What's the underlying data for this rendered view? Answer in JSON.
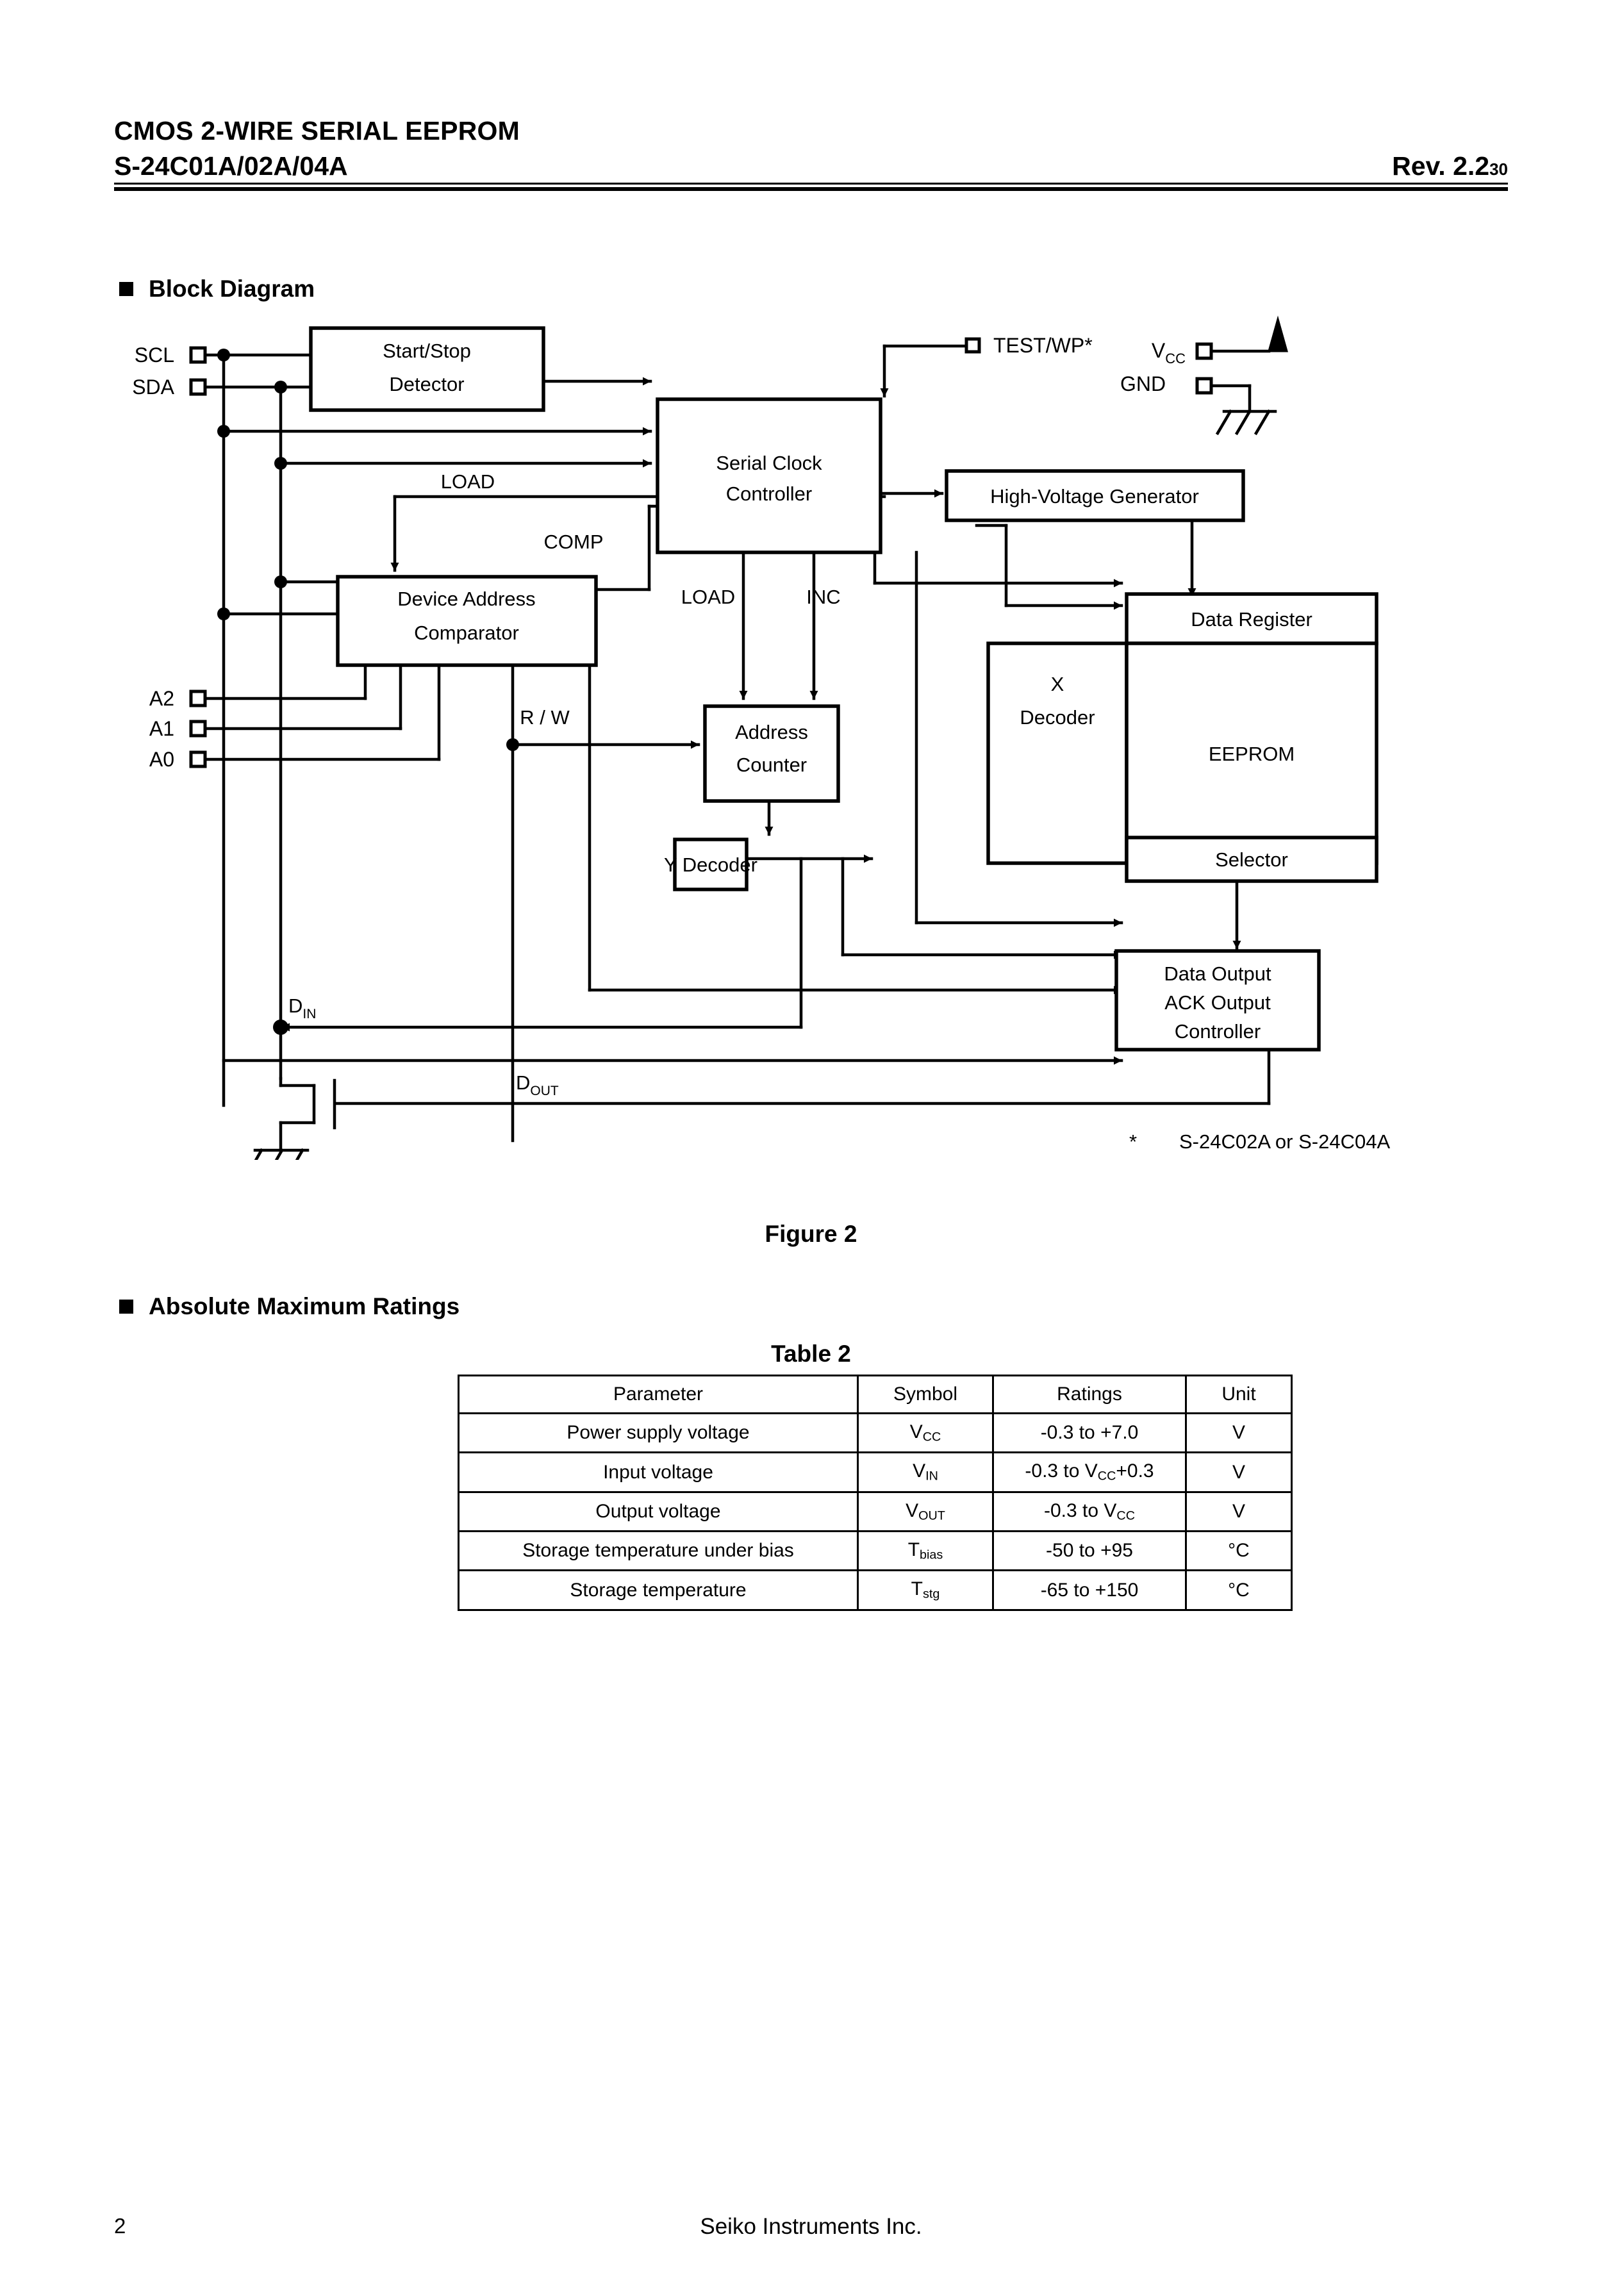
{
  "header": {
    "title": "CMOS 2-WIRE SERIAL  EEPROM",
    "part_number": "S-24C01A/02A/04A",
    "revision": "Rev. 2.2",
    "revision_sub": "30"
  },
  "sections": {
    "block_diagram": "Block Diagram",
    "absolute_maximum_ratings": "Absolute Maximum Ratings"
  },
  "figure": {
    "caption": "Figure 2",
    "footnote_mark": "*",
    "footnote_text": "S-24C02A or S-24C04A",
    "pins": {
      "scl": "SCL",
      "sda": "SDA",
      "a2": "A2",
      "a1": "A1",
      "a0": "A0",
      "test_wp": "TEST/WP*",
      "vcc": "V",
      "vcc_sub": "CC",
      "gnd": "GND"
    },
    "blocks": {
      "start_stop_detector_l1": "Start/Stop",
      "start_stop_detector_l2": "Detector",
      "serial_clock_controller_l1": "Serial Clock",
      "serial_clock_controller_l2": "Controller",
      "high_voltage_generator": "High-Voltage Generator",
      "device_address_comparator_l1": "Device Address",
      "device_address_comparator_l2": "Comparator",
      "address_counter_l1": "Address",
      "address_counter_l2": "Counter",
      "y_decoder": "Y Decoder",
      "x_decoder_l1": "X",
      "x_decoder_l2": "Decoder",
      "eeprom": "EEPROM",
      "data_register": "Data Register",
      "selector": "Selector",
      "data_output_l1": "Data Output",
      "data_output_l2": "ACK Output",
      "data_output_l3": "Controller"
    },
    "signals": {
      "load_1": "LOAD",
      "load_2": "LOAD",
      "comp": "COMP",
      "inc": "INC",
      "rw": "R / W",
      "din": "D",
      "din_sub": "IN",
      "dout": "D",
      "dout_sub": "OUT"
    }
  },
  "table": {
    "caption": "Table  2",
    "columns": [
      "Parameter",
      "Symbol",
      "Ratings",
      "Unit"
    ],
    "rows": [
      {
        "parameter": "Power supply voltage",
        "symbol": "V",
        "symbol_sub": "CC",
        "ratings": "-0.3 to +7.0",
        "ratings_parts": [
          {
            "t": "-0.3 to +7.0"
          }
        ],
        "unit": "V"
      },
      {
        "parameter": "Input voltage",
        "symbol": "V",
        "symbol_sub": "IN",
        "ratings": "-0.3 to VCC+0.3",
        "ratings_parts": [
          {
            "t": "-0.3 to V"
          },
          {
            "t": "CC",
            "sub": true
          },
          {
            "t": "+0.3"
          }
        ],
        "unit": "V"
      },
      {
        "parameter": "Output voltage",
        "symbol": "V",
        "symbol_sub": "OUT",
        "ratings": "-0.3 to VCC",
        "ratings_parts": [
          {
            "t": "-0.3 to V"
          },
          {
            "t": "CC",
            "sub": true
          }
        ],
        "unit": "V"
      },
      {
        "parameter": "Storage temperature under bias",
        "symbol": "T",
        "symbol_sub": "bias",
        "ratings": "-50 to +95",
        "ratings_parts": [
          {
            "t": "-50 to +95"
          }
        ],
        "unit": "°C"
      },
      {
        "parameter": "Storage temperature",
        "symbol": "T",
        "symbol_sub": "stg",
        "ratings": "-65 to +150",
        "ratings_parts": [
          {
            "t": "-65 to +150"
          }
        ],
        "unit": "°C"
      }
    ]
  },
  "footer": {
    "page_number": "2",
    "company": "Seiko Instruments Inc."
  },
  "colors": {
    "ink": "#000000",
    "paper": "#ffffff"
  }
}
